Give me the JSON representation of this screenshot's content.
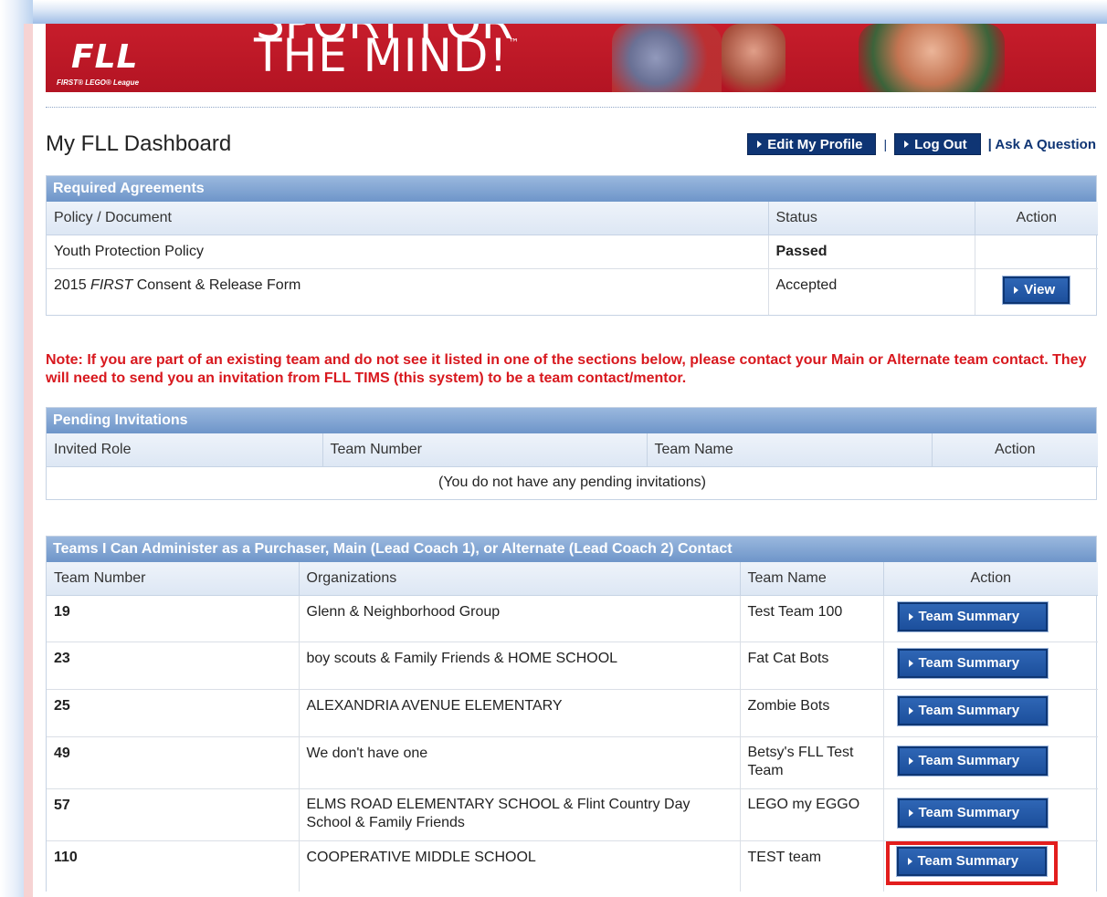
{
  "banner": {
    "logo_text": "FLL",
    "logo_sub": "FIRST® LEGO® League",
    "slogan_top": "SPORT FOR",
    "slogan": "THE MIND!",
    "slogan_tm": "™"
  },
  "header": {
    "title": "My FLL Dashboard",
    "edit_profile_label": "Edit My Profile",
    "logout_label": "Log Out",
    "separator": "|",
    "ask_label": "| Ask A Question"
  },
  "agreements": {
    "heading": "Required Agreements",
    "columns": [
      "Policy / Document",
      "Status",
      "Action"
    ],
    "rows": [
      {
        "document": "Youth Protection Policy",
        "status": "Passed",
        "action": ""
      },
      {
        "document_pre": "2015 ",
        "document_italic": "FIRST",
        "document_post": " Consent & Release Form",
        "status": "Accepted",
        "action": "View"
      }
    ]
  },
  "note": "Note: If you are part of an existing team and do not see it listed in one of the sections below, please contact your Main or Alternate team contact. They will need to send you an invitation from FLL TIMS (this system) to be a team contact/mentor.",
  "invitations": {
    "heading": "Pending Invitations",
    "columns": [
      "Invited Role",
      "Team Number",
      "Team Name",
      "Action"
    ],
    "empty_message": "(You do not have any pending invitations)"
  },
  "teams": {
    "heading": "Teams I Can Administer as a Purchaser, Main (Lead Coach 1), or Alternate (Lead Coach 2) Contact",
    "columns": [
      "Team Number",
      "Organizations",
      "Team Name",
      "Action"
    ],
    "button_label": "Team Summary",
    "rows": [
      {
        "number": "19",
        "org": "Glenn & Neighborhood Group",
        "name": "Test Team 100"
      },
      {
        "number": "23",
        "org": "boy scouts & Family Friends & HOME SCHOOL",
        "name": "Fat Cat Bots"
      },
      {
        "number": "25",
        "org": "ALEXANDRIA AVENUE ELEMENTARY",
        "name": "Zombie Bots"
      },
      {
        "number": "49",
        "org": "We don't have one",
        "name": "Betsy's FLL Test Team"
      },
      {
        "number": "57",
        "org": "ELMS ROAD ELEMENTARY SCHOOL & Flint Country Day School & Family Friends",
        "name": "LEGO my EGGO"
      },
      {
        "number": "110",
        "org": "COOPERATIVE MIDDLE SCHOOL",
        "name": "TEST team"
      }
    ]
  },
  "colors": {
    "banner_red": "#b31423",
    "navy": "#0f3574",
    "panel_header": "#7a9fd0",
    "note_red": "#d8181e",
    "highlight_red": "#e21d1d"
  }
}
